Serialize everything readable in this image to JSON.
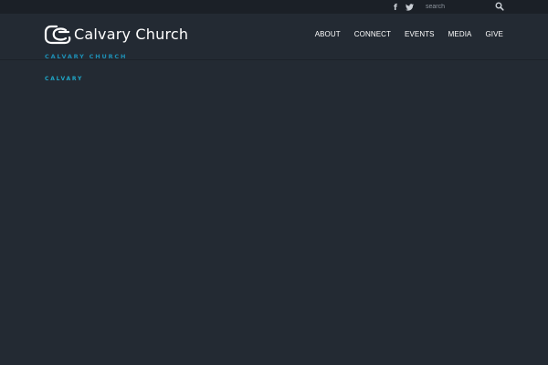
{
  "topbar": {
    "social": [
      {
        "icon": "facebook-icon",
        "glyph": "f"
      },
      {
        "icon": "twitter-icon"
      }
    ],
    "search": {
      "placeholder": "search",
      "value": ""
    },
    "search_icon": "search-icon"
  },
  "header": {
    "logo_text": "Calvary Church",
    "logo_subtext": "CALVARY CHURCH",
    "nav": [
      {
        "label": "ABOUT"
      },
      {
        "label": "CONNECT"
      },
      {
        "label": "EVENTS"
      },
      {
        "label": "MEDIA"
      },
      {
        "label": "GIVE"
      }
    ]
  },
  "main": {
    "section_label": "CALVARY"
  },
  "colors": {
    "background": "#232a33",
    "topbar": "#1b2027",
    "accent": "#1fa6c7",
    "text": "#ffffff"
  }
}
